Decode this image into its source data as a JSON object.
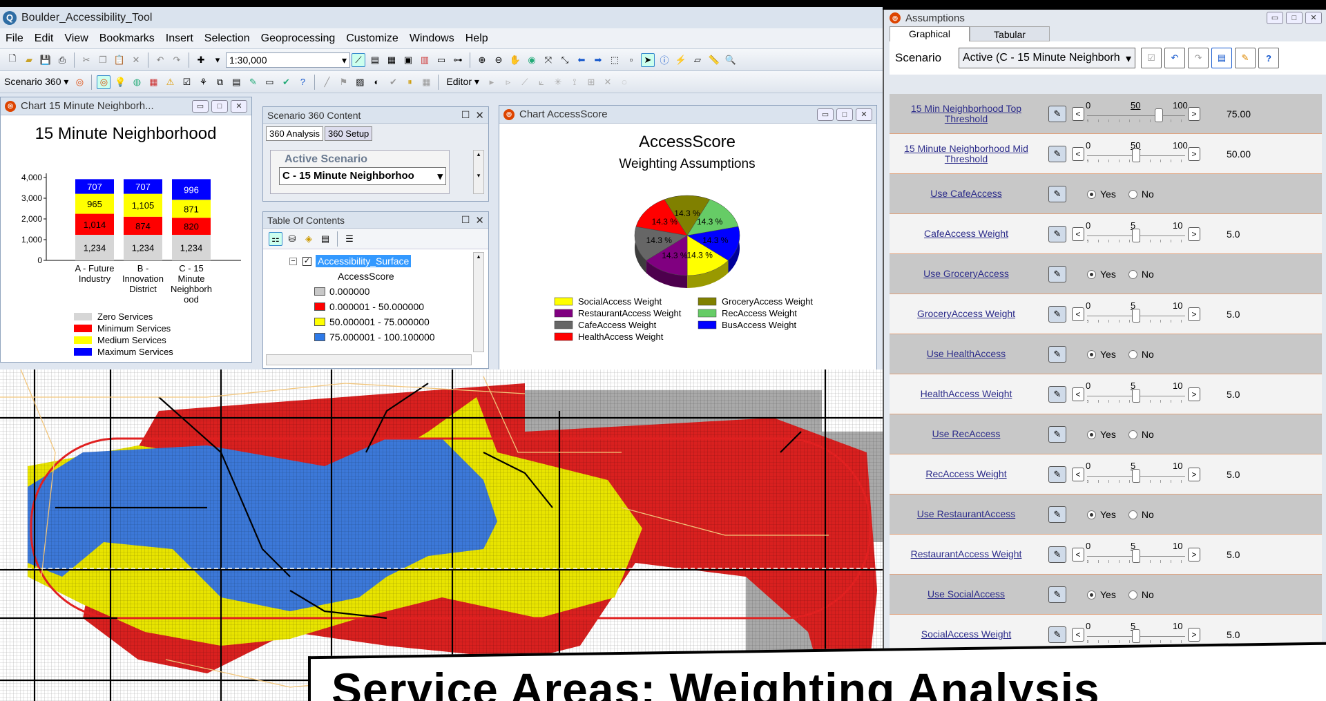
{
  "window": {
    "title": "Boulder_Accessibility_Tool"
  },
  "menu": [
    "File",
    "Edit",
    "View",
    "Bookmarks",
    "Insert",
    "Selection",
    "Geoprocessing",
    "Customize",
    "Windows",
    "Help"
  ],
  "toolbar": {
    "scale": "1:30,000",
    "scenario_label": "Scenario 360",
    "editor_label": "Editor"
  },
  "chart15": {
    "panel_title": "Chart 15 Minute Neighborh...",
    "chart_data": {
      "type": "bar",
      "stacked": true,
      "title": "15 Minute Neighborhood",
      "categories": [
        "A - Future Industry",
        "B - Innovation District",
        "C - 15 Minute Neighborhood"
      ],
      "category_lines": [
        [
          "A - Future",
          "Industry"
        ],
        [
          "B -",
          "Innovation",
          "District"
        ],
        [
          "C - 15",
          "Minute",
          "Neighborh",
          "ood"
        ]
      ],
      "series": [
        {
          "name": "Zero Services",
          "color": "#d6d6d6",
          "values": [
            1234,
            1234,
            1234
          ]
        },
        {
          "name": "Minimum Services",
          "color": "#ff0000",
          "values": [
            1014,
            874,
            820
          ]
        },
        {
          "name": "Medium Services",
          "color": "#ffff00",
          "values": [
            965,
            1105,
            871
          ]
        },
        {
          "name": "Maximum Services",
          "color": "#0000ff",
          "values": [
            707,
            707,
            996
          ]
        }
      ],
      "value_labels": [
        [
          "1,234",
          "1,014",
          "965",
          "707"
        ],
        [
          "1,234",
          "874",
          "1,105",
          "707"
        ],
        [
          "1,234",
          "820",
          "871",
          "996"
        ]
      ],
      "yticks": [
        "0",
        "1,000",
        "2,000",
        "3,000",
        "4,000"
      ],
      "ylim": [
        0,
        4000
      ]
    }
  },
  "s360": {
    "title": "Scenario 360 Content",
    "tabs": [
      "360 Analysis",
      "360 Setup"
    ],
    "active_scenario_label": "Active Scenario",
    "active_scenario_value": "C - 15 Minute Neighborhoo"
  },
  "toc": {
    "title": "Table Of Contents",
    "layer": "Accessibility_Surface",
    "field": "AccessScore",
    "classes": [
      {
        "label": "0.000000",
        "color": "#c8c8c8"
      },
      {
        "label": "0.000001 - 50.000000",
        "color": "#ff0000"
      },
      {
        "label": "50.000001 - 75.000000",
        "color": "#ffff00"
      },
      {
        "label": "75.000001 - 100.100000",
        "color": "#2e7ae8"
      }
    ]
  },
  "access": {
    "panel_title": "Chart AccessScore",
    "chart_data": {
      "type": "pie",
      "title": "AccessScore",
      "subtitle": "Weighting Assumptions",
      "slices": [
        {
          "name": "GroceryAccess Weight",
          "value": 14.3,
          "label": "14.3 %",
          "color": "#808000"
        },
        {
          "name": "RecAccess Weight",
          "value": 14.3,
          "label": "14.3 %",
          "color": "#66cc66"
        },
        {
          "name": "BusAccess Weight",
          "value": 14.3,
          "label": "14.3 %",
          "color": "#0000ff"
        },
        {
          "name": "SocialAccess Weight",
          "value": 14.3,
          "label": "14.3 %",
          "color": "#ffff00"
        },
        {
          "name": "RestaurantAccess Weight",
          "value": 14.3,
          "label": "14.3 %",
          "color": "#800080"
        },
        {
          "name": "CafeAccess Weight",
          "value": 14.3,
          "label": "14.3 %",
          "color": "#666666"
        },
        {
          "name": "HealthAccess Weight",
          "value": 14.3,
          "label": "14.3 %",
          "color": "#ff0000"
        }
      ],
      "legend": [
        {
          "name": "SocialAccess Weight",
          "color": "#ffff00"
        },
        {
          "name": "GroceryAccess Weight",
          "color": "#808000"
        },
        {
          "name": "RestaurantAccess Weight",
          "color": "#800080"
        },
        {
          "name": "RecAccess Weight",
          "color": "#66cc66"
        },
        {
          "name": "CafeAccess Weight",
          "color": "#666666"
        },
        {
          "name": "BusAccess Weight",
          "color": "#0000ff"
        },
        {
          "name": "HealthAccess Weight",
          "color": "#ff0000"
        }
      ]
    }
  },
  "assumptions": {
    "title": "Assumptions",
    "tabs": [
      "Graphical",
      "Tabular"
    ],
    "scenario_label": "Scenario",
    "scenario_value": "Active (C - 15 Minute Neighborh",
    "yes_label": "Yes",
    "no_label": "No",
    "rows": [
      {
        "type": "slider",
        "label": "15 Min Neighborhood Top Threshold",
        "min": "0",
        "mid": "50",
        "max": "100",
        "value": "75.00",
        "pos": 0.75
      },
      {
        "type": "slider",
        "label": "15 Minute Neighborhood Mid Threshold",
        "min": "0",
        "mid": "50",
        "max": "100",
        "value": "50.00",
        "pos": 0.5
      },
      {
        "type": "radio",
        "label": "Use CafeAccess",
        "selected": "Yes"
      },
      {
        "type": "slider",
        "label": "CafeAccess Weight",
        "min": "0",
        "mid": "5",
        "max": "10",
        "value": "5.0",
        "pos": 0.5
      },
      {
        "type": "radio",
        "label": "Use GroceryAccess",
        "selected": "Yes"
      },
      {
        "type": "slider",
        "label": "GroceryAccess Weight",
        "min": "0",
        "mid": "5",
        "max": "10",
        "value": "5.0",
        "pos": 0.5
      },
      {
        "type": "radio",
        "label": "Use HealthAccess",
        "selected": "Yes"
      },
      {
        "type": "slider",
        "label": "HealthAccess Weight",
        "min": "0",
        "mid": "5",
        "max": "10",
        "value": "5.0",
        "pos": 0.5
      },
      {
        "type": "radio",
        "label": "Use RecAccess",
        "selected": "Yes"
      },
      {
        "type": "slider",
        "label": "RecAccess Weight",
        "min": "0",
        "mid": "5",
        "max": "10",
        "value": "5.0",
        "pos": 0.5
      },
      {
        "type": "radio",
        "label": "Use RestaurantAccess",
        "selected": "Yes"
      },
      {
        "type": "slider",
        "label": "RestaurantAccess Weight",
        "min": "0",
        "mid": "5",
        "max": "10",
        "value": "5.0",
        "pos": 0.5
      },
      {
        "type": "radio",
        "label": "Use SocialAccess",
        "selected": "Yes"
      },
      {
        "type": "slider",
        "label": "SocialAccess Weight",
        "min": "0",
        "mid": "5",
        "max": "10",
        "value": "5.0",
        "pos": 0.5
      }
    ]
  },
  "banner": {
    "text": "Service Areas: Weighting Analysis"
  },
  "colors": {
    "red": "#d9201f",
    "yellow": "#e8e400",
    "blue": "#3c78d8",
    "grey": "#8c8c8c"
  }
}
